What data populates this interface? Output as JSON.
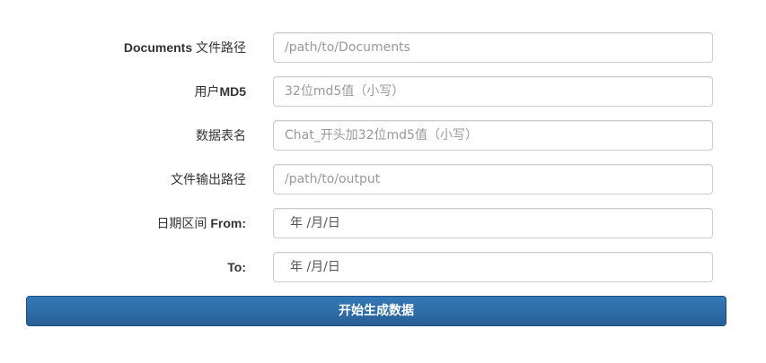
{
  "form": {
    "fields": [
      {
        "label_bold": "Documents",
        "label_text": " 文件路径",
        "placeholder": "/path/to/Documents"
      },
      {
        "label_prefix": "用户",
        "label_bold": "MD5",
        "placeholder": "32位md5值（小写）"
      },
      {
        "label_text": "数据表名",
        "placeholder": "Chat_开头加32位md5值（小写）"
      },
      {
        "label_text": "文件输出路径",
        "placeholder": "/path/to/output"
      }
    ],
    "date_from": {
      "label_prefix": "日期区间 ",
      "label_bold": "From:",
      "value": "年 /月/日"
    },
    "date_to": {
      "label_bold": "To:",
      "value": "年 /月/日"
    },
    "submit_label": "开始生成数据"
  }
}
